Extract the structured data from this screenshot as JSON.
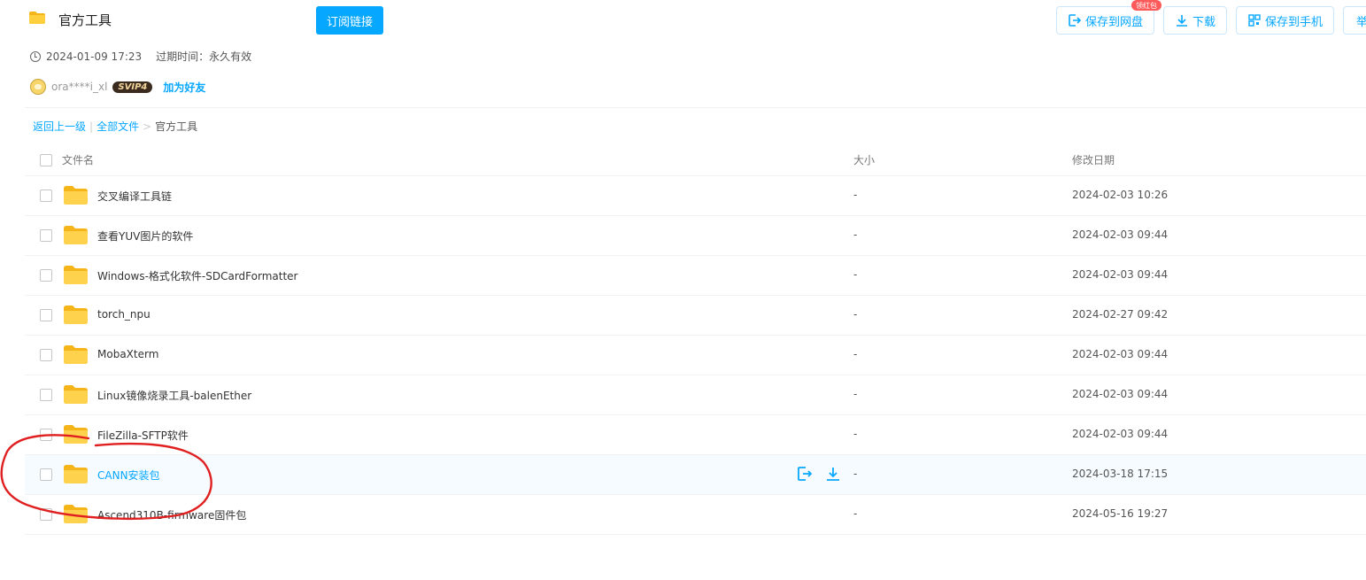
{
  "header": {
    "title": "官方工具",
    "subscribe_label": "订阅链接",
    "buttons": {
      "save_to_netdisk": "保存到网盘",
      "download": "下载",
      "save_to_phone": "保存到手机",
      "report": "举"
    },
    "red_badge": "领红包"
  },
  "meta": {
    "created": "2024-01-09 17:23",
    "expire": "过期时间：永久有效"
  },
  "user": {
    "name": "ora****i_xl",
    "badge": "SVIP4",
    "add_friend": "加为好友"
  },
  "breadcrumb": {
    "back": "返回上一级",
    "sep1": "|",
    "all_files": "全部文件",
    "sep2": ">",
    "current": "官方工具"
  },
  "table": {
    "headers": {
      "name": "文件名",
      "size": "大小",
      "date": "修改日期"
    },
    "rows": [
      {
        "name": "交叉编译工具链",
        "size": "-",
        "date": "2024-02-03 10:26"
      },
      {
        "name": "查看YUV图片的软件",
        "size": "-",
        "date": "2024-02-03 09:44"
      },
      {
        "name": "Windows-格式化软件-SDCardFormatter",
        "size": "-",
        "date": "2024-02-03 09:44"
      },
      {
        "name": "torch_npu",
        "size": "-",
        "date": "2024-02-27 09:42"
      },
      {
        "name": "MobaXterm",
        "size": "-",
        "date": "2024-02-03 09:44"
      },
      {
        "name": "Linux镜像烧录工具-balenEther",
        "size": "-",
        "date": "2024-02-03 09:44"
      },
      {
        "name": "FileZilla-SFTP软件",
        "size": "-",
        "date": "2024-02-03 09:44"
      },
      {
        "name": "CANN安装包",
        "size": "-",
        "date": "2024-03-18 17:15",
        "hovered": true
      },
      {
        "name": "Ascend310B-firmware固件包",
        "size": "-",
        "date": "2024-05-16 19:27"
      }
    ]
  },
  "colors": {
    "accent": "#06a7ff",
    "folder": "#ffd24d",
    "annotation": "#e02020",
    "hover_row": "#f5fbff"
  }
}
